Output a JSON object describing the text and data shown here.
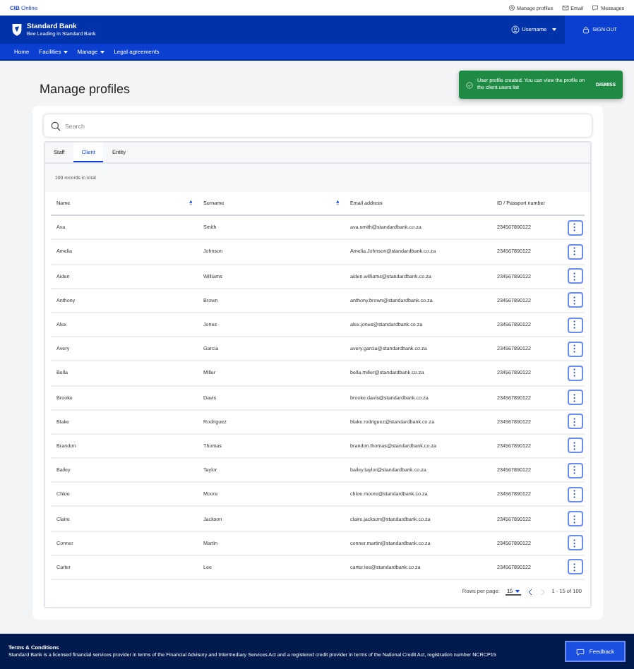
{
  "top_bar": {
    "brand_bold": "CIB",
    "brand": "Online",
    "links": [
      "Manage profiles",
      "Email",
      "Messages"
    ]
  },
  "header": {
    "bank": "Standard Bank",
    "tagline": "Bee Leading in Standard Bank",
    "user": "Username",
    "sign_out": "SIGN OUT"
  },
  "nav": [
    {
      "label": "Home",
      "dropdown": false
    },
    {
      "label": "Facilities",
      "dropdown": true
    },
    {
      "label": "Manage",
      "dropdown": true
    },
    {
      "label": "Legal agreements",
      "dropdown": false
    }
  ],
  "page_title": "Manage profiles",
  "toast": {
    "message": "User profile created. You can view the profile on the client users list",
    "action": "DISMISS"
  },
  "search": {
    "placeholder": "Search"
  },
  "tabs": [
    {
      "label": "Staff",
      "selected": false
    },
    {
      "label": "Client",
      "selected": true
    },
    {
      "label": "Entity",
      "selected": false
    }
  ],
  "records": "100 records in total",
  "table": {
    "columns": [
      {
        "label": "Name",
        "sortable": true
      },
      {
        "label": "Surname",
        "sortable": true
      },
      {
        "label": "Email address",
        "sortable": false
      },
      {
        "label": "ID / Passport number",
        "sortable": false
      }
    ],
    "rows": [
      [
        "Ava",
        "Smith",
        "ava.smith@standardbank.co.za",
        "234567890122"
      ],
      [
        "Amelia",
        "Johnson",
        "Amelia.Johnson@standardbank.co.za",
        "234567890122"
      ],
      [
        "Aiden",
        "Williams",
        "aiden.williams@standardbank.co.za",
        "234567890122"
      ],
      [
        "Anthony",
        "Brown",
        "anthony.brown@standardbank.co.za",
        "234567890122"
      ],
      [
        "Alex",
        "Jones",
        "alex.jones@standardbank.co.za",
        "234567890122"
      ],
      [
        "Avery",
        "Garcia",
        "avery.garcia@standardbank.co.za",
        "234567890122"
      ],
      [
        "Bella",
        "Miller",
        "bella.miller@standardbank.co.za",
        "234567890122"
      ],
      [
        "Brooke",
        "Davis",
        "brooke.davis@standardbank.co.za",
        "234567890122"
      ],
      [
        "Blake",
        "Rodriguez",
        "blake.rodriguez@standardbank.co.za",
        "234567890122"
      ],
      [
        "Brandon",
        "Thomas",
        "brandon.thomas@standardbank.co.za",
        "234567890122"
      ],
      [
        "Bailey",
        "Taylor",
        "bailey.taylor@standardbank.co.za",
        "234567890122"
      ],
      [
        "Chloe",
        "Moore",
        "chloe.moore@standardbank.co.za",
        "234567890122"
      ],
      [
        "Claire",
        "Jackson",
        "claire.jackson@standardbank.co.za",
        "234567890122"
      ],
      [
        "Conner",
        "Martin",
        "conner.martin@standardbank.co.za",
        "234567890122"
      ],
      [
        "Carter",
        "Lee",
        "carter.lee@standardbank.co.za",
        "234567890122"
      ]
    ]
  },
  "pagination": {
    "rows_label": "Rows per page:",
    "rows_value": "15",
    "range": "1 - 15 of 100",
    "prev_disabled": false,
    "next_disabled": true
  },
  "footer": {
    "title": "Terms & Conditions",
    "text": "Standard Bank is a licensed financial services provider in terms of the Financial Advisory and Intermediary Services Act and a registered credit provider in terms of the National Credit Act, registration number NCRCP15",
    "feedback": "Feedback"
  }
}
